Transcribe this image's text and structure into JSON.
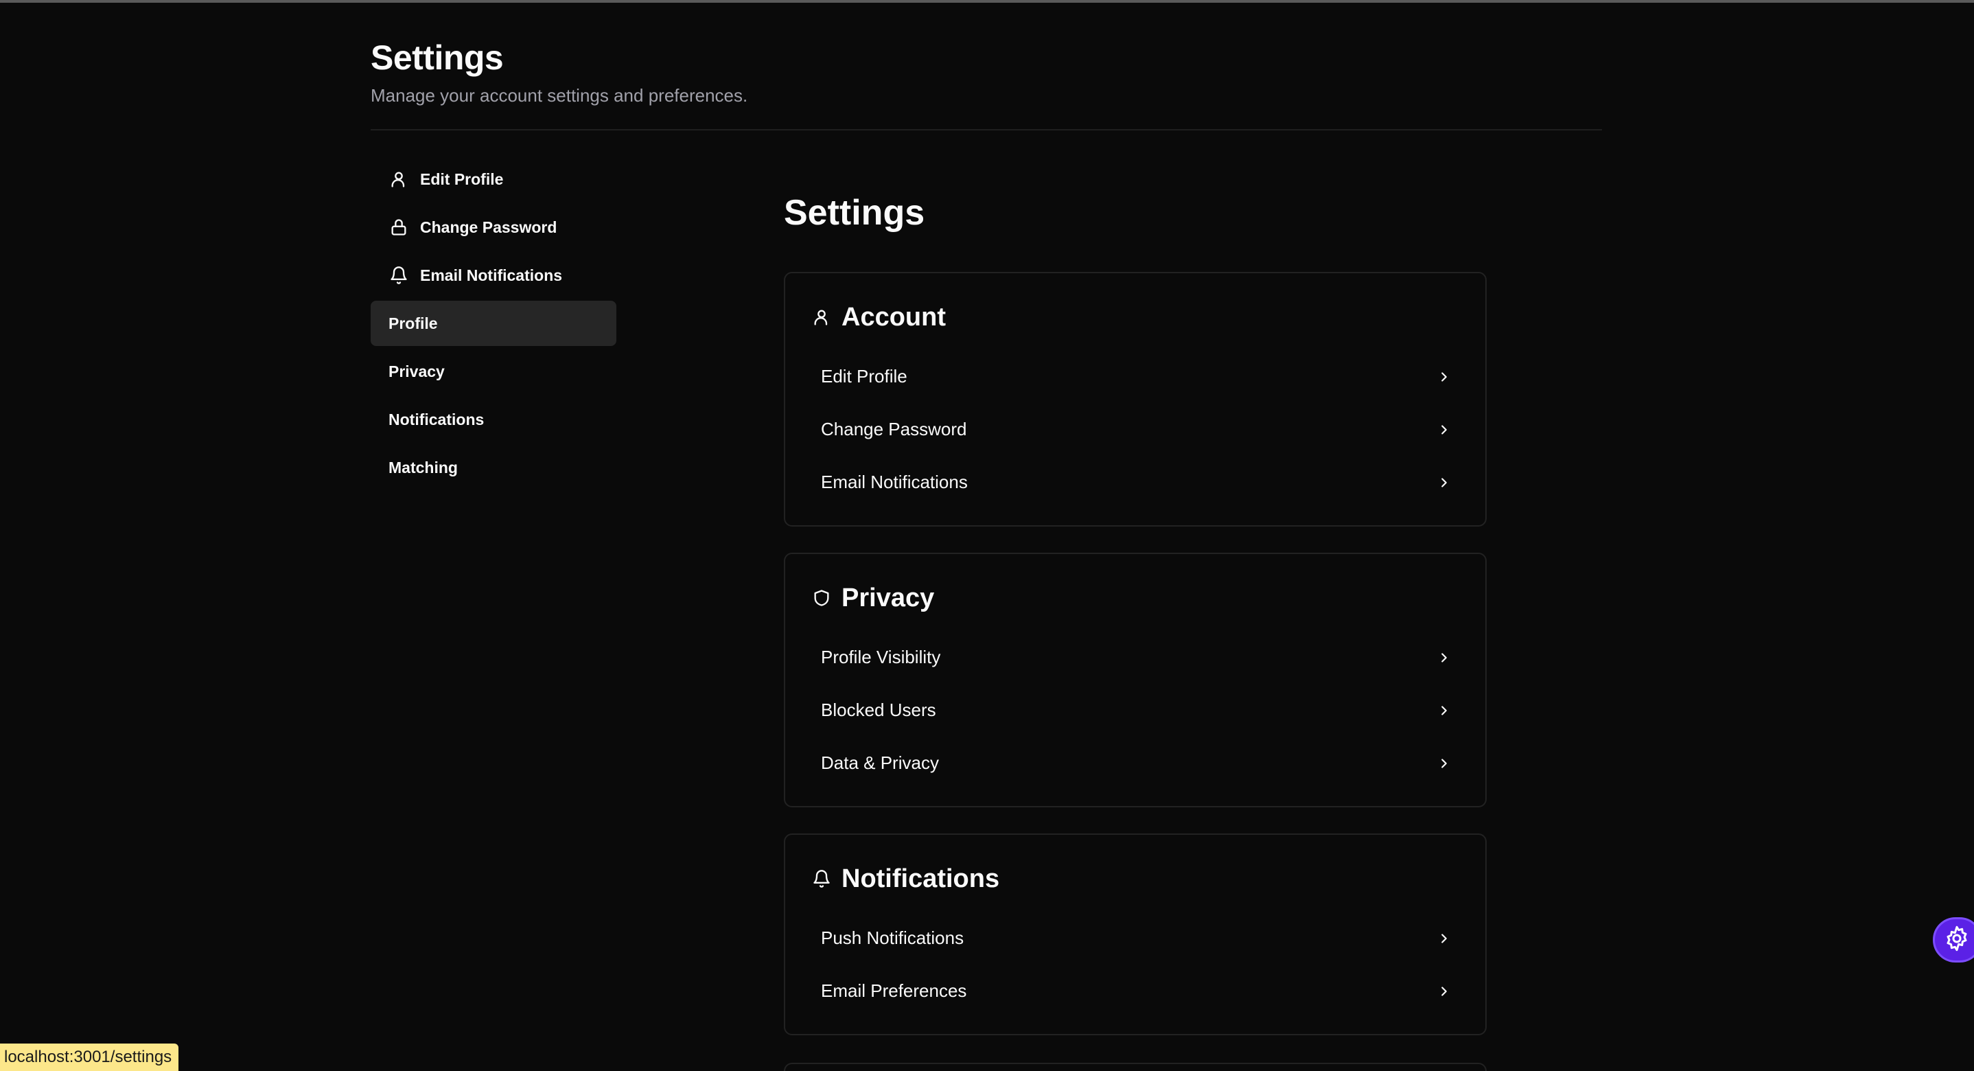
{
  "header": {
    "title": "Settings",
    "subtitle": "Manage your account settings and preferences."
  },
  "sidebar": {
    "items": [
      {
        "label": "Edit Profile",
        "icon": "user-icon"
      },
      {
        "label": "Change Password",
        "icon": "lock-icon"
      },
      {
        "label": "Email Notifications",
        "icon": "bell-icon"
      },
      {
        "label": "Profile",
        "icon": ""
      },
      {
        "label": "Privacy",
        "icon": ""
      },
      {
        "label": "Notifications",
        "icon": ""
      },
      {
        "label": "Matching",
        "icon": ""
      }
    ],
    "active": "Profile"
  },
  "main": {
    "title": "Settings",
    "sections": [
      {
        "title": "Account",
        "icon": "user-icon",
        "items": [
          "Edit Profile",
          "Change Password",
          "Email Notifications"
        ]
      },
      {
        "title": "Privacy",
        "icon": "shield-icon",
        "items": [
          "Profile Visibility",
          "Blocked Users",
          "Data & Privacy"
        ]
      },
      {
        "title": "Notifications",
        "icon": "bell-icon",
        "items": [
          "Push Notifications",
          "Email Preferences"
        ]
      }
    ]
  },
  "status_bar": {
    "url": "localhost:3001/settings"
  },
  "colors": {
    "background": "#0a0a0a",
    "active_nav": "#262626",
    "card_border": "#222222",
    "status_bg": "#fce78a",
    "floating_button": "#5b21e6"
  }
}
